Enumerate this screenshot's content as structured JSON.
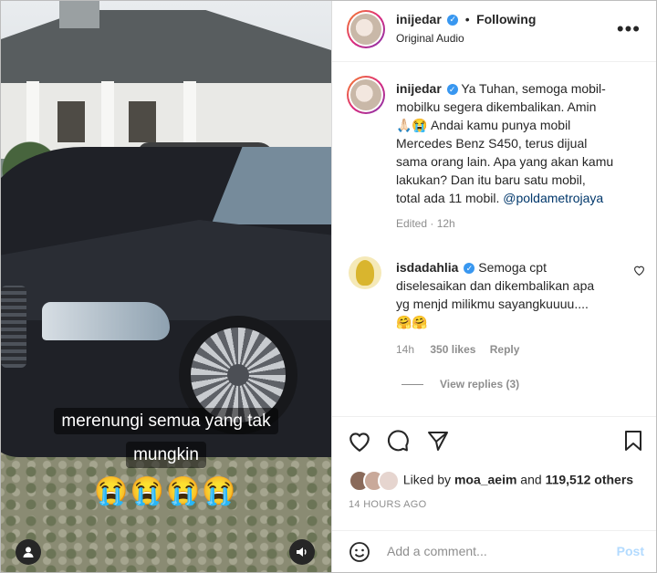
{
  "post": {
    "username": "inijedar",
    "following_label": "Following",
    "audio_label": "Original Audio",
    "caption_lines": [
      "Ya Tuhan, semoga mobil-",
      "mobilku segera dikembalikan. Amin",
      "🙏🏻😭 Andai kamu punya mobil",
      "Mercedes Benz S450, terus dijual",
      "sama orang lain. Apa yang akan kamu",
      "lakukan? Dan itu baru satu mobil,",
      "total ada 11 mobil. "
    ],
    "mention": "@poldametrojaya",
    "edited_label": "Edited",
    "edited_time": "12h"
  },
  "video": {
    "caption_line1": "merenungi semua yang tak",
    "caption_line2": "mungkin",
    "emojis": "😭😭😭😭"
  },
  "comment": {
    "username": "isdadahlia",
    "lines": [
      "Semoga cpt",
      "diselesaikan dan dikembalikan apa",
      "yg menjd milikmu sayangkuuuu....",
      "🤗🤗"
    ],
    "time": "14h",
    "likes": "350 likes",
    "reply_label": "Reply",
    "view_replies": "View replies (3)"
  },
  "likes": {
    "liked_by_prefix": "Liked by ",
    "liked_by_user": "moa_aeim",
    "liked_by_suffix": " and ",
    "others_count": "119,512 others",
    "timestamp": "14 HOURS AGO"
  },
  "composer": {
    "placeholder": "Add a comment...",
    "post_label": "Post"
  },
  "colors": {
    "accent": "#3897f0",
    "link": "#00376b",
    "post_disabled": "#b3dbff"
  }
}
